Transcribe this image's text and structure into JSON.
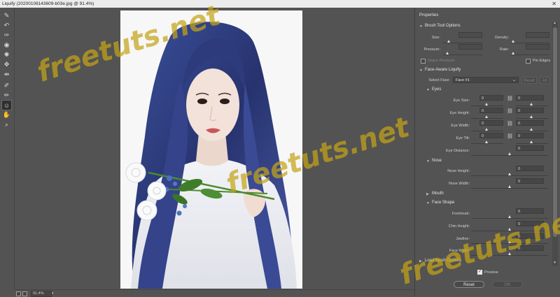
{
  "window": {
    "title": "Liquify (20200106143609-b03e.jpg @ 91.4%)",
    "close_glyph": "✕"
  },
  "tools": [
    {
      "name": "forward-warp-tool-icon",
      "glyph": "✎"
    },
    {
      "name": "reconstruct-tool-icon",
      "glyph": "↶"
    },
    {
      "name": "smooth-tool-icon",
      "glyph": "✑"
    },
    {
      "name": "twirl-clockwise-tool-icon",
      "glyph": "◉"
    },
    {
      "name": "pucker-tool-icon",
      "glyph": "✺"
    },
    {
      "name": "bloat-tool-icon",
      "glyph": "✥"
    },
    {
      "name": "push-left-tool-icon",
      "glyph": "⇹"
    },
    {
      "name": "freeze-mask-tool-icon",
      "glyph": "✐"
    },
    {
      "name": "thaw-mask-tool-icon",
      "glyph": "✏"
    },
    {
      "name": "face-tool-icon",
      "glyph": "☺"
    },
    {
      "name": "hand-tool-icon",
      "glyph": "✋"
    },
    {
      "name": "zoom-tool-icon",
      "glyph": "⌕"
    }
  ],
  "status": {
    "zoom": "91.4%"
  },
  "panel": {
    "title": "Properties",
    "brush": {
      "header": "Brush Tool Options",
      "size_label": "Size:",
      "density_label": "Density:",
      "pressure_label": "Pressure:",
      "rate_label": "Rate:",
      "size": "",
      "density": "",
      "pressure": "",
      "rate": "",
      "stylus_label": "Stylus Pressure",
      "pin_label": "Pin Edges"
    },
    "face": {
      "header": "Face-Aware Liquify",
      "select_label": "Select Face:",
      "select_value": "Face #1",
      "reset_label": "Reset",
      "all_label": "All"
    },
    "eyes": {
      "header": "Eyes",
      "size_label": "Eye Size:",
      "size_l": "0",
      "size_r": "0",
      "height_label": "Eye Height:",
      "height_l": "0",
      "height_r": "0",
      "width_label": "Eye Width:",
      "width_l": "0",
      "width_r": "0",
      "tilt_label": "Eye Tilt:",
      "tilt_l": "0",
      "tilt_r": "0",
      "distance_label": "Eye Distance:",
      "distance": "0"
    },
    "nose": {
      "header": "Nose",
      "height_label": "Nose Height:",
      "height": "0",
      "width_label": "Nose Width:",
      "width": "0"
    },
    "mouth": {
      "header": "Mouth"
    },
    "shape": {
      "header": "Face Shape",
      "forehead_label": "Forehead:",
      "forehead": "0",
      "chin_label": "Chin Height:",
      "chin": "0",
      "jaw_label": "Jawline:",
      "jaw": "0",
      "width_label": "Face Width:",
      "width": "0"
    },
    "load_mesh": "Load Mesh Options",
    "preview_label": "Preview",
    "reset_button": "Reset",
    "ok_button": "OK"
  },
  "watermark": "freetuts.net"
}
